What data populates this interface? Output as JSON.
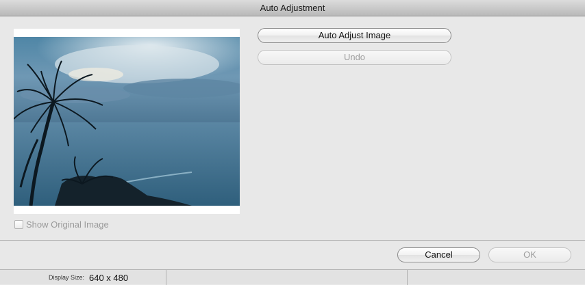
{
  "window": {
    "title": "Auto Adjustment"
  },
  "preview": {
    "show_original_label": "Show Original Image",
    "show_original_checked": false
  },
  "buttons": {
    "auto_adjust_label": "Auto Adjust Image",
    "undo_label": "Undo",
    "cancel_label": "Cancel",
    "ok_label": "OK"
  },
  "statusbar": {
    "display_size_label": "Display Size:",
    "display_size_value": "640 x 480"
  }
}
